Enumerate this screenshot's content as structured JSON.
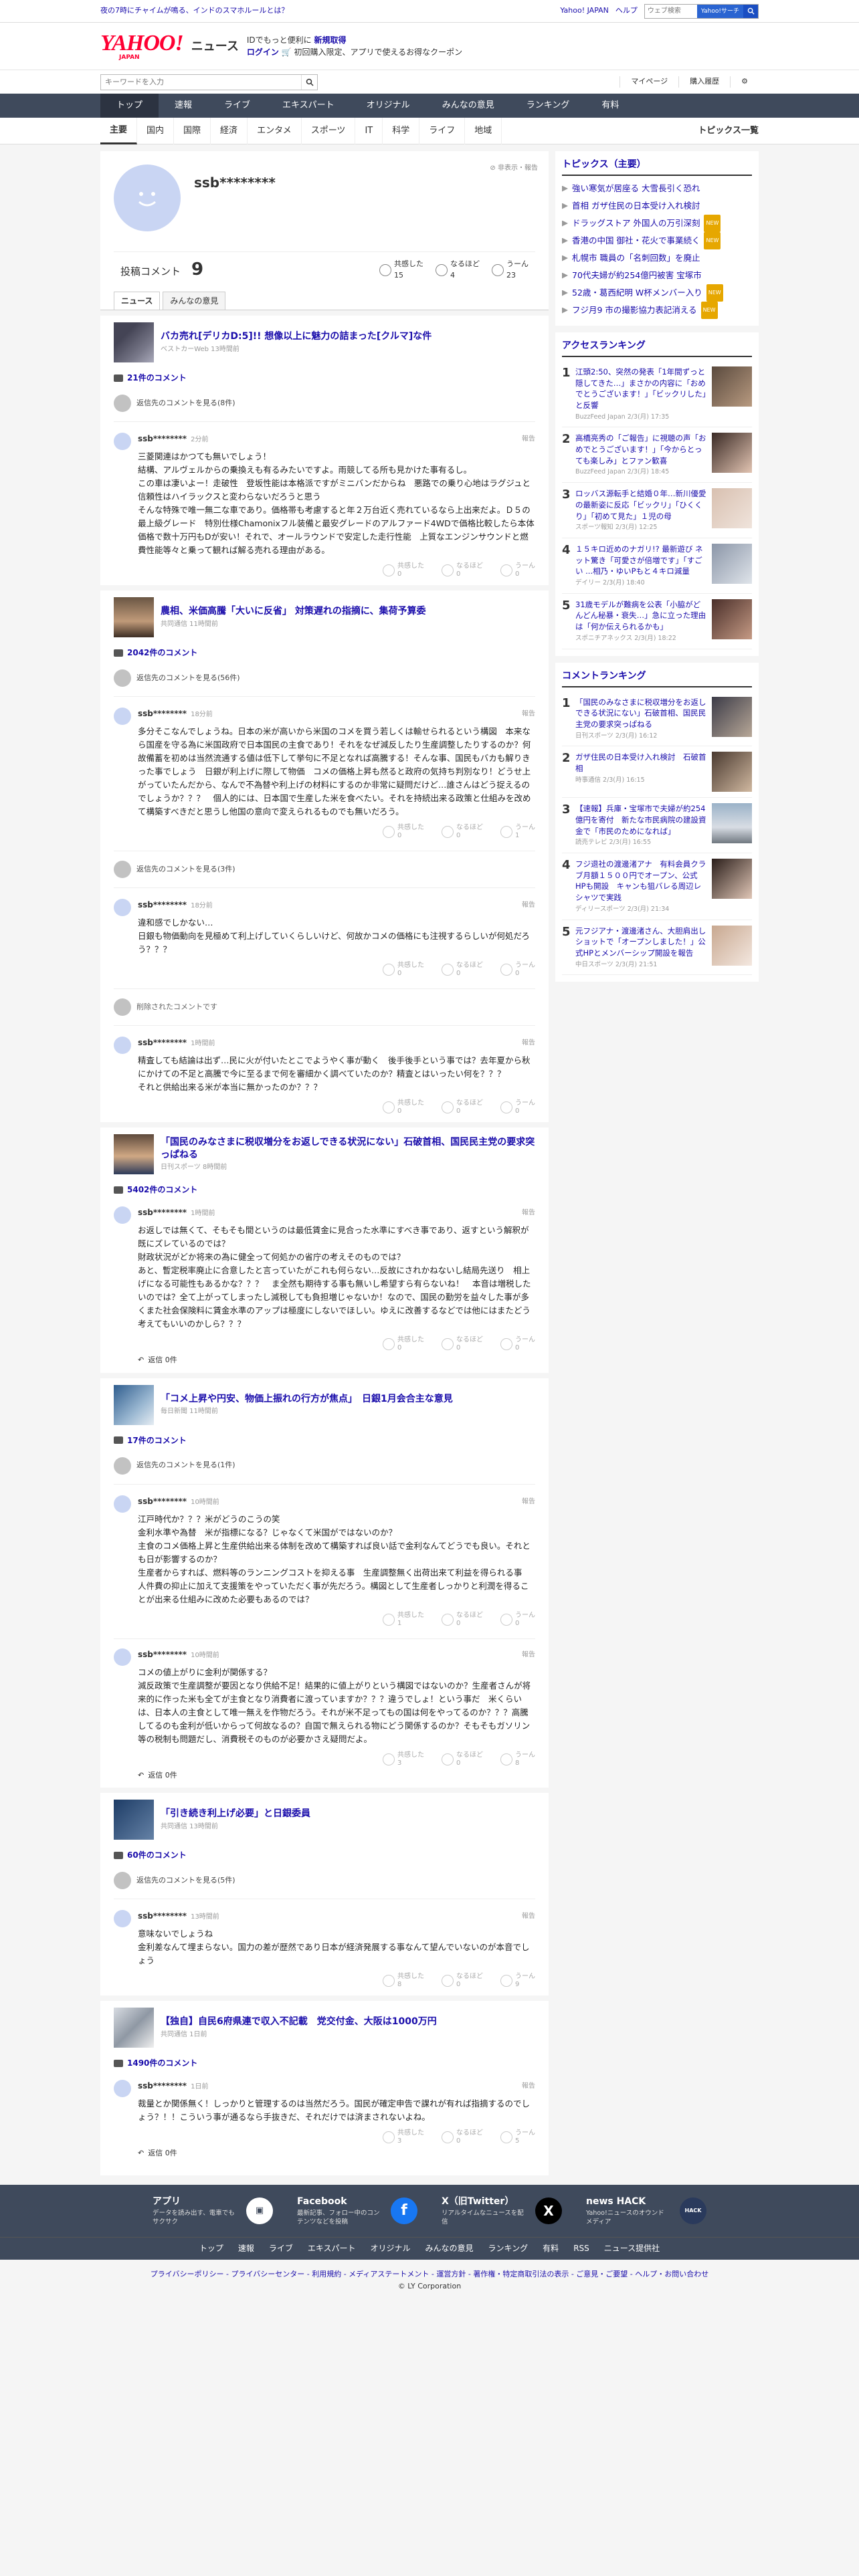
{
  "topstrip": {
    "promo": "夜の7時にチャイムが鳴る、インドのスマホルールとは？",
    "links": [
      "Yahoo! JAPAN",
      "ヘルプ"
    ],
    "search_placeholder": "ウェブ検索",
    "search_button": "Yahoo!サーチ"
  },
  "header": {
    "logo": "YAHOO!",
    "logo_sub": "JAPAN",
    "service": "ニュース",
    "msg1": "IDでもっと便利に",
    "msg1b": "新規取得",
    "msg2": "ログイン",
    "msg2b": "初回購入限定、アプリで使えるお得なクーポン"
  },
  "searchbar": {
    "placeholder": "キーワードを入力",
    "links": [
      "マイページ",
      "購入履歴"
    ]
  },
  "mainnav": [
    "トップ",
    "速報",
    "ライブ",
    "エキスパート",
    "オリジナル",
    "みんなの意見",
    "ランキング",
    "有料"
  ],
  "subnav": {
    "cats": [
      "主要",
      "国内",
      "国際",
      "経済",
      "エンタメ",
      "スポーツ",
      "IT",
      "科学",
      "ライフ",
      "地域"
    ],
    "all": "トピックス一覧"
  },
  "profile": {
    "name": "ssb********",
    "report": "非表示・報告",
    "count_label": "投稿コメント",
    "count": "9",
    "reactions": [
      {
        "label": "共感した",
        "n": "15"
      },
      {
        "label": "なるほど",
        "n": "4"
      },
      {
        "label": "うーん",
        "n": "23"
      }
    ],
    "tabs": [
      "ニュース",
      "みんなの意見"
    ]
  },
  "articles": [
    {
      "title": "バカ売れ[デリカD:5]!! 想像以上に魅力の詰まった[クルマ]な件",
      "meta": "ベストカーWeb 13時間前",
      "count": "21件のコメント",
      "parent": "返信先のコメントを見る(8件)",
      "comments": [
        {
          "user": "ssb********",
          "time": "2分前",
          "text": "三菱関連はかつても無いでしょう！\n結構、アルヴェルからの乗換えも有るみたいですよ。雨競してる所も見かけた事有るし。\nこの車は凄いよー！走破性　登坂性能は本格派ですがミニバンだからね　悪路での乗り心地はラグジュと信頼性はハイラックスと変わらないだろうと思う\nそんな特殊で唯一無二な車であり。価格帯も考慮すると年２万台近く売れているなら上出来だよ。Ｄ５の最上級グレード　特別仕様Chamonixフル装備と最安グレードのアルファード4WDで価格比較したら本体価格で数十万円もDが安い！それで、オールラウンドで安定した走行性能　上質なエンジンサウンドと燃費性能等々と乗って観れば解る売れる理由がある。",
          "acts": [
            "0",
            "0",
            "0"
          ]
        }
      ]
    },
    {
      "title": "農相、米価高騰「大いに反省」 対策遅れの指摘に、集荷予算委",
      "meta": "共同通信 11時間前",
      "count": "2042件のコメント",
      "parent": "返信先のコメントを見る(56件)",
      "comments": [
        {
          "user": "ssb********",
          "time": "18分前",
          "text": "多分そこなんでしょうね。日本の米が高いから米国のコメを買う若しくは輸せられるという構図　本来なら国産を守る為に米国政府で日本国民の主食であり！それをなぜ減反したり生産調整したりするのか？何故備蓄を初めは当然流通する値は低下して挙句に不足となれば高騰する！そんな事、国民もバカも解りきった事でしょう　日銀が利上げに際して物価　コメの価格上昇も然ると政府の気持ち判別なり！どうせ上がっていたんだから、なんで不為替や利上げの材料にするのか非常に疑問だけど…誰さんはどう捉えるのでしょうか？？？　個人的には、日本国で生産した米を食べたい。それを持続出来る政策と仕組みを改めて構築すべきだと思うし他国の意向で変えられるものでも無いだろう。",
          "acts": [
            "0",
            "0",
            "1"
          ]
        },
        {
          "user": "ssb********",
          "time": "18分前",
          "text": "違和感でしかない…\n日銀も物価動向を見極めて利上げしていくらしいけど、何故かコメの価格にも注視するらしいが何処だろう？？？",
          "acts": [
            "0",
            "0",
            "0"
          ],
          "parent": "返信先のコメントを見る(3件)"
        },
        {
          "user": "ssb********",
          "time": "1時間前",
          "text": "精査しても結論は出ず…民に火が付いたとこでようやく事が動く　後手後手という事では？去年夏から秋にかけての不足と高騰で今に至るまで何を審細かく調べていたのか？精査とはいったい何を？？？\nそれと供給出来る米が本当に無かったのか？？？",
          "acts": [
            "0",
            "0",
            "0"
          ],
          "deleted": "削除されたコメントです"
        }
      ]
    },
    {
      "title": "「国民のみなさまに税収増分をお返しできる状況にない」石破首相、国民民主党の要求突っぱねる",
      "meta": "日刊スポーツ 8時間前",
      "count": "5402件のコメント",
      "comments": [
        {
          "user": "ssb********",
          "time": "1時間前",
          "text": "お返しでは無くて、そもそも間というのは最低賃金に見合った水準にすべき事であり、返すという解釈が既にズレているのでは？\n財政状況がどか将来の為に健全って何処かの省庁の考えそのものでは？\nあと、暫定税率廃止に合意したと言っていたがこれも何らない…反故にされかねないし結局先送り　相上げになる可能性もあるかな？？？　ま全然も期待する事も無いし希望すら有らないね！　本音は増税したいのでは？全て上がってしまったし減税しても負担増じゃないか！なので、国民の勤労を益々した事が多くまた社会保険料に賃金水準のアップは極度にしないでほしい。ゆえに改善するなどでは他にはまたどう考えてもいいのかしら？？？",
          "acts": [
            "0",
            "0",
            "0"
          ],
          "reply": "返信 0件"
        }
      ]
    },
    {
      "title": "「コメ上昇や円安、物価上振れの行方が焦点」　日銀1月会合主な意見",
      "meta": "毎日新聞 11時間前",
      "count": "17件のコメント",
      "parent": "返信先のコメントを見る(1件)",
      "comments": [
        {
          "user": "ssb********",
          "time": "10時間前",
          "text": "江戸時代か？？？米がどうのこうの笑\n金利水準や為替　米が指標になる？じゃなくて米国がではないのか？\n主食のコメ価格上昇と生産供給出来る体制を改めて構築すれば良い話で金利なんてどうでも良い。それとも日が影響するのか？\n生産者からすれば、燃料等のランニングコストを抑える事　生産調整無く出荷出来て利益を得られる事　人件費の抑止に加えて支援策をやっていただく事が先だろう。構図として生産者しっかりと利潤を得ることが出来る仕組みに改めた必要もあるのでは？",
          "acts": [
            "1",
            "0",
            "0"
          ]
        },
        {
          "user": "ssb********",
          "time": "10時間前",
          "text": "コメの値上がりに金利が関係する？\n減反政策で生産調整が要因となり供給不足！結果的に値上がりという構図ではないのか？生産者さんが将来的に作った米も全てが主食となり消費者に渡っていますか？？？違うでしょ！という事だ　米くらいは、日本人の主食として唯一無えを作物だろう。それが米不足ってもの国は何をやってるのか？？？高騰してるのも金利が低いからって何故なるの？自国で無えられる物にどう関係するのか？そもそもガソリン等の税制も問題だし、消費税そのものが必要かさえ疑問だよ。",
          "acts": [
            "3",
            "0",
            "8"
          ],
          "reply": "返信 0件"
        }
      ]
    },
    {
      "title": "「引き続き利上げ必要」と日銀委員",
      "meta": "共同通信 13時間前",
      "count": "60件のコメント",
      "parent": "返信先のコメントを見る(5件)",
      "comments": [
        {
          "user": "ssb********",
          "time": "13時間前",
          "text": "意味ないでしょうね\n金利差なんて埋まらない。国力の差が歴然であり日本が経済発展する事なんて望んでいないのが本音でしょう",
          "acts": [
            "8",
            "0",
            "9"
          ]
        }
      ]
    },
    {
      "title": "【独自】自民6府県連で収入不記載　党交付金、大阪は1000万円",
      "meta": "共同通信 1日前",
      "count": "1490件のコメント",
      "comments": [
        {
          "user": "ssb********",
          "time": "1日前",
          "text": "裁量とか関係無く！しっかりと管理するのは当然だろう。国民が確定申告で課れが有れば指摘するのでしょう？！！こういう事が通るなら手抜きだ、それだけでは済まされないよね。",
          "acts": [
            "3",
            "0",
            "5"
          ],
          "reply": "返信 0件"
        }
      ]
    }
  ],
  "sidebar": {
    "topics_title": "トピックス（主要）",
    "topics": [
      {
        "t": "強い寒気が居座る 大雪長引く恐れ"
      },
      {
        "t": "首相 ガザ住民の日本受け入れ検討"
      },
      {
        "t": "ドラッグストア 外国人の万引深刻",
        "b": "NEW"
      },
      {
        "t": "香港の中国 御社・花火で事業続く",
        "b": "NEW"
      },
      {
        "t": "札幌市 職員の「名刺回数」を廃止"
      },
      {
        "t": "70代夫婦が約254億円被害 宝塚市"
      },
      {
        "t": "52歳・葛西紀明 W杯メンバー入り",
        "b": "NEW"
      },
      {
        "t": "フジ月9 市の撮影協力表記消える",
        "b": "NEW"
      }
    ],
    "ranking_title": "アクセスランキング",
    "ranking": [
      {
        "t": "江頭2:50、突然の発表「1年間ずっと隠してきた…」まさかの内容に「おめでとうございます！」「ビックリした」と反響",
        "s": "BuzzFeed Japan 2/3(月) 17:35"
      },
      {
        "t": "高橋亮秀の「ご報告」に視聴の声「おめでとうございます！」「今からとっても楽しみ」とファン歓喜",
        "s": "BuzzFeed Japan 2/3(月) 18:45"
      },
      {
        "t": "ロッバス源転手と結婚０年…新川優愛の最新姿に反応「ビックリ」「ひくくり」「初めて見た」１児の母",
        "s": "スポーツ報知 2/3(月) 12:25"
      },
      {
        "t": "１５キロ近めのナガリ!? 最新遊び ネット驚き「可愛さが倍増です」「すごい ...相乃・ゆいPもと４キロ減量",
        "s": "デイリー 2/3(月) 18:40"
      },
      {
        "t": "31歳モデルが難病を公表「小脇がどんどん秘暴・衰失…」急に立った理由は「何か伝えられるかも」",
        "s": "スポニチアネックス 2/3(月) 18:22"
      }
    ],
    "cranking_title": "コメントランキング",
    "cranking": [
      {
        "t": "「国民のみなさまに税収増分をお返しできる状況にない」石破首相、国民民主党の要求突っぱねる",
        "s": "日刊スポーツ 2/3(月) 16:12"
      },
      {
        "t": "ガザ住民の日本受け入れ検討　石破首相",
        "s": "時事通信 2/3(月) 16:15"
      },
      {
        "t": "【速報】兵庫・宝塚市で夫婦が約254億円を寄付　新たな市民病院の建設資金で「市民のためになれば」",
        "s": "読売テレビ 2/3(月) 16:55"
      },
      {
        "t": "フジ退社の渡邊渚アナ　有料会員クラブ月額１５００円でオープン、公式HPも開設　キャンも狙バレる周辺レシャツで実践",
        "s": "ディリースポーツ 2/3(月) 21:34"
      },
      {
        "t": "元フジアナ・渡邊渚さん、大胆肩出しショットで「オープンしました！」公式HPとメンバーシップ開設を報告",
        "s": "中日スポーツ 2/3(月) 21:51"
      }
    ]
  },
  "footer": {
    "apps": [
      {
        "t": "アプリ",
        "d": "データを読み出す、電車でもサクサク"
      },
      {
        "t": "Facebook",
        "d": "最新記事、フォロー中のコンテンツなどを投稿"
      },
      {
        "t": "X（旧Twitter）",
        "d": "リアルタイムなニュースを配信"
      },
      {
        "t": "news HACK",
        "d": "Yahoo!ニュースのオウンドメディア"
      }
    ],
    "nav": [
      "トップ",
      "速報",
      "ライブ",
      "エキスパート",
      "オリジナル",
      "みんなの意見",
      "ランキング",
      "有料",
      "RSS",
      "ニュース提供社"
    ],
    "links": "プライバシーポリシー - プライバシーセンター - 利用規約 - メディアステートメント - 運営方針 - 著作権・特定商取引法の表示 - ご意見・ご要望 - ヘルプ・お問い合わせ",
    "copyright": "© LY Corporation"
  }
}
